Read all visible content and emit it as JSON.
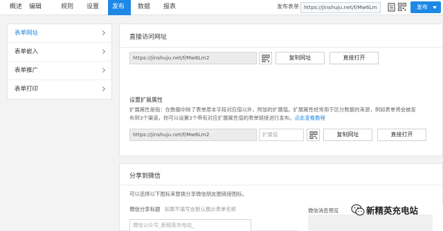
{
  "topbar": {
    "tabs": [
      {
        "label": "概述"
      },
      {
        "label": "编辑"
      },
      {
        "label": "规则"
      },
      {
        "label": "设置"
      },
      {
        "label": "发布",
        "active": true
      },
      {
        "label": "数据"
      },
      {
        "label": "报表"
      }
    ],
    "publish_form_label": "发布表单",
    "publish_url": "https://jinshuju.net/f/Mw6Lm",
    "icons": [
      "document-icon",
      "qrcode-icon"
    ],
    "publish_button": "发布"
  },
  "sidebar": {
    "items": [
      {
        "label": "表单网址",
        "active": true
      },
      {
        "label": "表单嵌入"
      },
      {
        "label": "表单推广"
      },
      {
        "label": "表单打印"
      }
    ]
  },
  "direct_access": {
    "title": "直接访问网址",
    "url": "https://jinshuju.net/f/Mw6Lm2",
    "copy_button": "复制网址",
    "open_button": "直接打开"
  },
  "extension": {
    "title": "设置扩展属性",
    "description_1": "扩展属性是指：在数据中除了表单原本字段对应值以外，附加的扩展值。扩展属性经常用于区分数据的来源，例如表单将会被发",
    "description_2": "布到3个渠道，你可以设置3个带有对应扩展属性值的表单链接进行发布。",
    "link_text": "点此查看教程",
    "url": "https://jinshuju.net/f/Mw6Lm2",
    "input_placeholder": "扩展值",
    "copy_button": "复制网址",
    "open_button": "直接打开"
  },
  "wechat": {
    "title": "分享到微信",
    "description": "可以选择以下图标来替换分享微信朋友圈链接图标。",
    "share_title_label": "微信分享标题",
    "share_title_hint": "如果不填写会默认展示表单名称",
    "share_title_value": "微信公众号_新精英充电站_",
    "preview_label": "微信消息预览"
  },
  "watermark": {
    "text": "新精英充电站"
  }
}
